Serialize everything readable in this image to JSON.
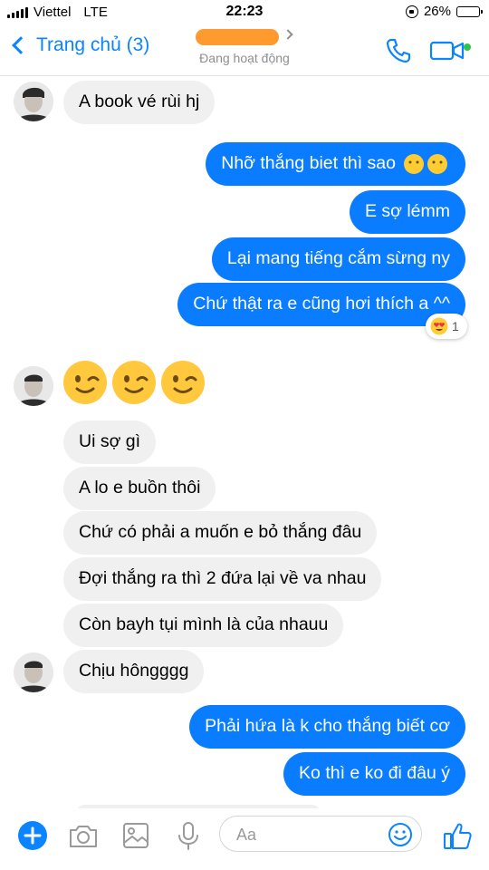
{
  "status_bar": {
    "carrier": "Viettel",
    "network": "LTE",
    "time": "22:23",
    "battery": "26%",
    "battery_level": 0.26
  },
  "header": {
    "back_label": "Trang chủ (3)",
    "status": "Đang hoạt động",
    "icons": [
      "chevron-left-icon",
      "phone-icon",
      "video-camera-icon"
    ],
    "active_dot_color": "#31c24a"
  },
  "messages": [
    {
      "from": "them",
      "text": "A book vé rùi hj"
    },
    {
      "from": "me",
      "text": "Nhỡ thắng biet thì sao"
    },
    {
      "from": "me",
      "text": "E sợ lémm"
    },
    {
      "from": "me",
      "text": "Lại mang tiếng cắm sừng ny"
    },
    {
      "from": "me",
      "text": "Chứ thật ra e cũng hơi thích a ^^",
      "reaction": {
        "emoji": "heart-eyes-icon",
        "count": "1"
      }
    },
    {
      "from": "them",
      "emoji": [
        "winking-face-icon",
        "winking-face-icon",
        "winking-face-icon"
      ]
    },
    {
      "from": "them",
      "text": "Ui sợ gì"
    },
    {
      "from": "them",
      "text": "A lo e buồn thôi"
    },
    {
      "from": "them",
      "text": "Chứ có phải a muốn e bỏ thắng đâu"
    },
    {
      "from": "them",
      "text": "Đợi thắng ra thì 2 đứa lại về va nhau"
    },
    {
      "from": "them",
      "text": "Còn bayh tụi mình là của nhauu"
    },
    {
      "from": "them",
      "text": "Chịu hôngggg"
    },
    {
      "from": "me",
      "text": "Phải hứa là k cho thắng biết cơ"
    },
    {
      "from": "me",
      "text": "Ko thì e ko đi đâu ý"
    }
  ],
  "composer": {
    "placeholder": "Aa",
    "icons": [
      "plus-icon",
      "camera-icon",
      "photo-icon",
      "microphone-icon",
      "emoji-icon",
      "thumbs-up-icon"
    ]
  },
  "colors": {
    "accent": "#0a84ff",
    "outgoing_bubble": "#0a7cff",
    "incoming_bubble": "#f0f0f0",
    "redaction": "#ff9a2e"
  }
}
